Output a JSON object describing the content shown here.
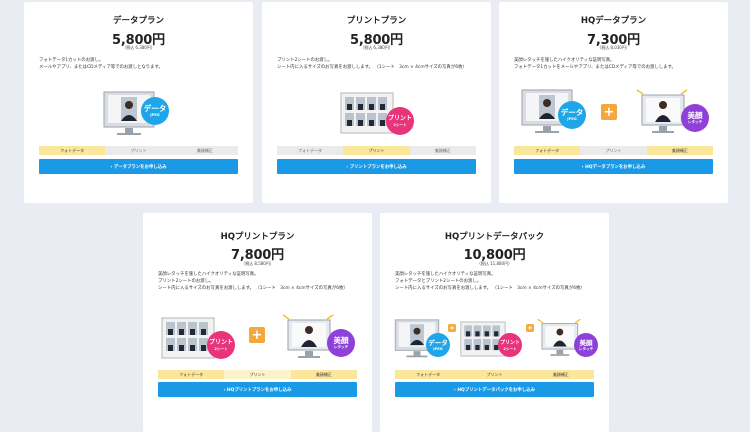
{
  "colors": {
    "apply_bg": "#1a99e6",
    "tab_active": "#fbe79b",
    "tab_inactive": "#ebebeb",
    "badge_data": "#1fa6e8",
    "badge_print": "#e8347a",
    "badge_retouch": "#8e40d8",
    "plus": "#f4a73a"
  },
  "icons": {
    "plus": "+",
    "arrow": "›"
  },
  "badges": {
    "data": {
      "main": "データ",
      "sub": "JPEG"
    },
    "print": {
      "main": "プリント",
      "sub": "2シート"
    },
    "retouch": {
      "main": "美顔",
      "sub": "レタッチ"
    }
  },
  "tabs": {
    "photo_data": "フォトデータ",
    "print": "プリント",
    "retouch": "美顔補正"
  },
  "cards": [
    {
      "title": "データプラン",
      "price": "5,800円",
      "tax": "（税込 6,380円）",
      "desc": "フォトデータ1カットのお渡し。\nメールやアプリ、またはCDメディア等でのお渡しとなります。",
      "button": "› データプランをお申し込み"
    },
    {
      "title": "プリントプラン",
      "price": "5,800円",
      "tax": "（税込 6,380円）",
      "desc": "プリント2シートのお渡し。\nシート内に入るサイズのお写真をお渡しします。 （1シート　3cm × 4cmサイズの写真が6枚）",
      "button": "› プリントプランをお申し込み"
    },
    {
      "title": "HQデータプラン",
      "price": "7,300円",
      "tax": "（税込 8,030円）",
      "desc": "美顔レタッチを施したハイクオリティな証明写真。\nフォトデータ1カットをメールやアプリ、またはCDメディア等でのお渡しします。",
      "button": "› HQデータプランをお申し込み"
    },
    {
      "title": "HQプリントプラン",
      "price": "7,800円",
      "tax": "（税込 8,580円）",
      "desc": "美顔レタッチを施したハイクオリティな証明写真。\nプリント2シートのお渡し。\nシート内に入るサイズのお写真をお渡しします。 （1シート　3cm × 4cmサイズの写真が6枚）",
      "button": "› HQプリントプランをお申し込み"
    },
    {
      "title": "HQプリントデータパック",
      "price": "10,800円",
      "tax": "（税込 11,880円）",
      "desc": "美顔レタッチを施したハイクオリティな証明写真。\nフォトデータとプリント2シートのお渡し。\nシート内に入るサイズのお写真をお渡しします。 （1シート　3cm × 4cmサイズの写真が6枚）",
      "button": "› HQプリントデータパックをお申し込み"
    }
  ]
}
